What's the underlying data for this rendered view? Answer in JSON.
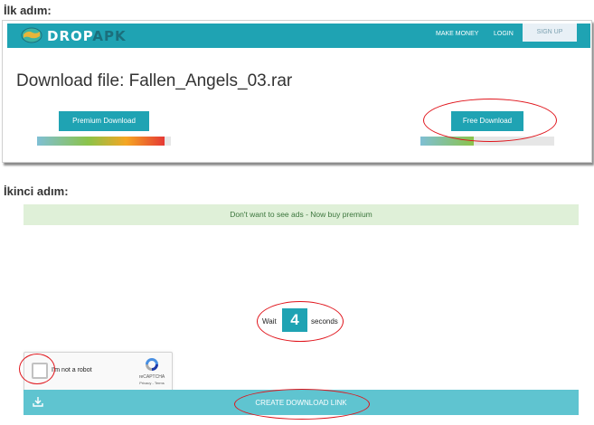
{
  "step1": {
    "label": "İlk adım:"
  },
  "step2": {
    "label": "İkinci adım:"
  },
  "header": {
    "logo_main": "DROP",
    "logo_accent": "APK",
    "nav": {
      "make_money": "MAKE MONEY",
      "login": "LOGIN",
      "signup": "SIGN UP"
    },
    "brand_color": "#1fa3b3"
  },
  "download": {
    "title": "Download file: Fallen_Angels_03.rar",
    "premium_button": "Premium Download",
    "free_button": "Free Download",
    "premium_speed_fraction": 0.95,
    "free_speed_fraction": 0.4
  },
  "page2": {
    "ad_banner": "Don't want to see ads - Now buy premium",
    "wait_prefix": "Wait",
    "wait_seconds": "4",
    "wait_suffix": "seconds",
    "recaptcha_label": "I'm not a robot",
    "recaptcha_brand": "reCAPTCHA",
    "recaptcha_terms": "Privacy - Terms",
    "create_link": "CREATE DOWNLOAD LINK",
    "download_icon": "download-icon"
  },
  "annotation_color": "#e0141b"
}
